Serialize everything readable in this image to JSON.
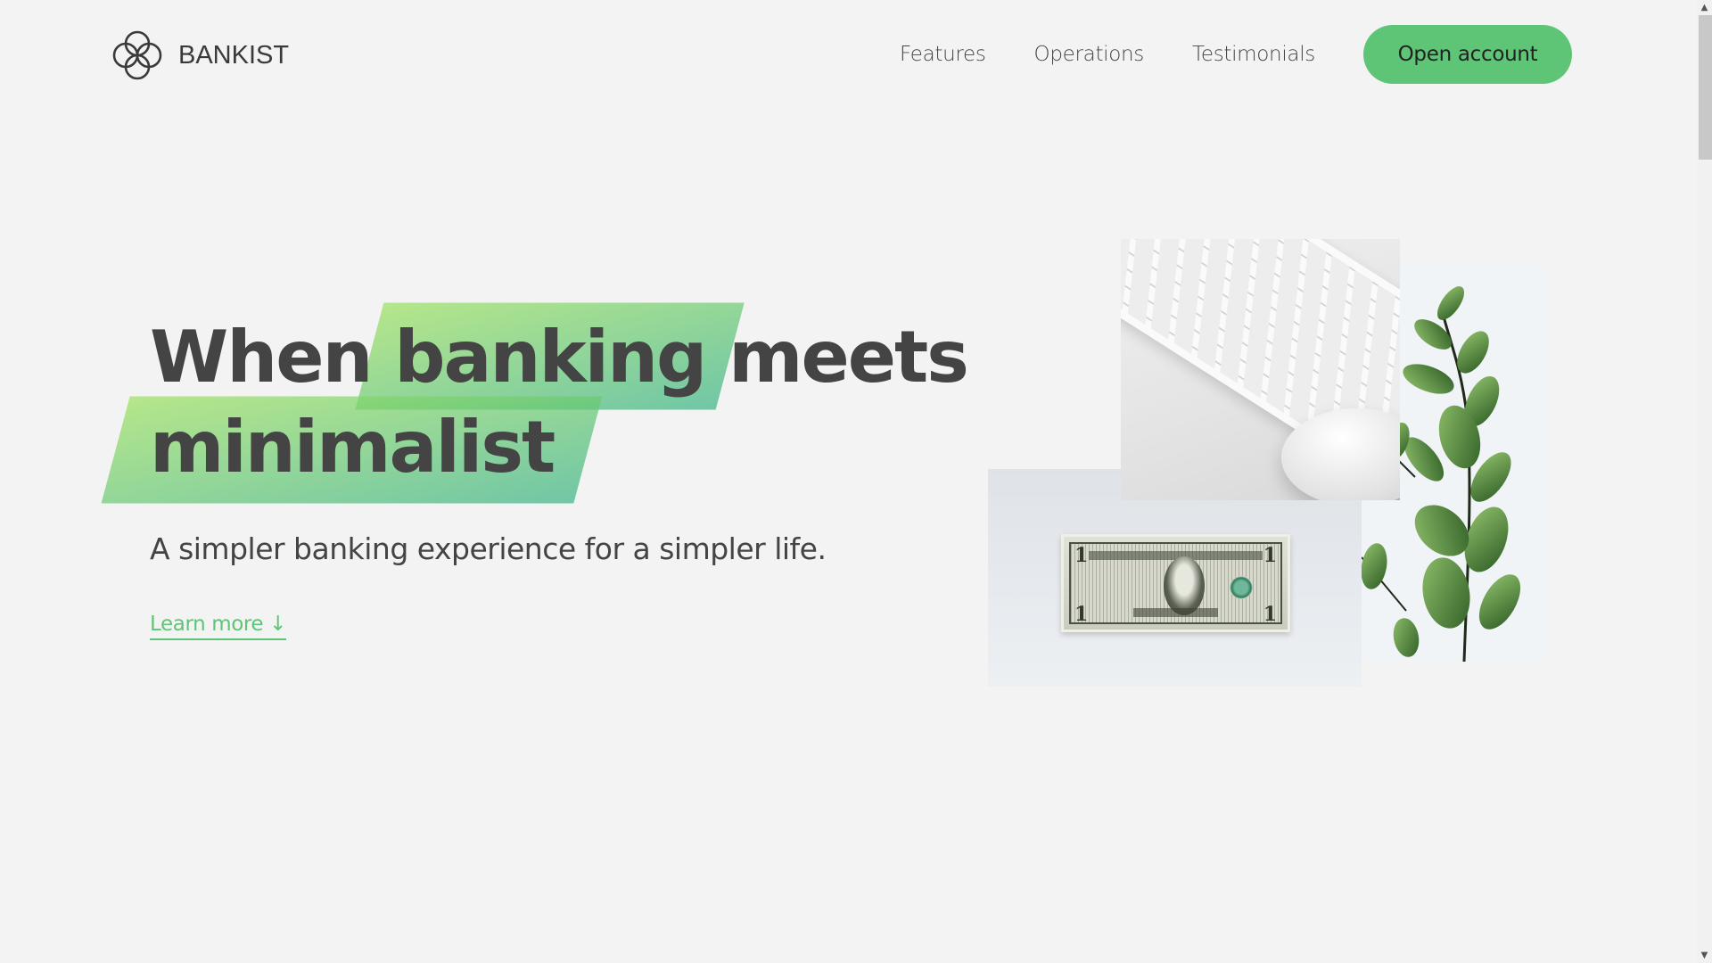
{
  "brand": {
    "name": "BANKIST",
    "logo_icon": "four-circles-logo-icon",
    "accent_color": "#5ec576",
    "highlight_gradient": [
      "#39b385",
      "#9be15d"
    ],
    "text_color": "#444444",
    "background_color": "#f3f3f3"
  },
  "nav": {
    "links": [
      {
        "label": "Features"
      },
      {
        "label": "Operations"
      },
      {
        "label": "Testimonials"
      }
    ],
    "cta_label": "Open account"
  },
  "hero": {
    "headline": {
      "part1": "When",
      "highlight1": "banking",
      "part2": "meets",
      "highlight2": "minimalist"
    },
    "subtitle": "A simpler banking experience for a simpler life.",
    "learn_more_label": "Learn more",
    "learn_more_icon": "↓",
    "images": [
      {
        "name": "keyboard-and-mouse-image",
        "alt": "White keyboard and mouse"
      },
      {
        "name": "dollar-bill-image",
        "alt": "One dollar bill"
      },
      {
        "name": "eucalyptus-plant-image",
        "alt": "Green eucalyptus branch"
      }
    ],
    "bill_denomination": "1"
  },
  "scrollbar": {
    "up_icon": "▲",
    "down_icon": "▼"
  }
}
